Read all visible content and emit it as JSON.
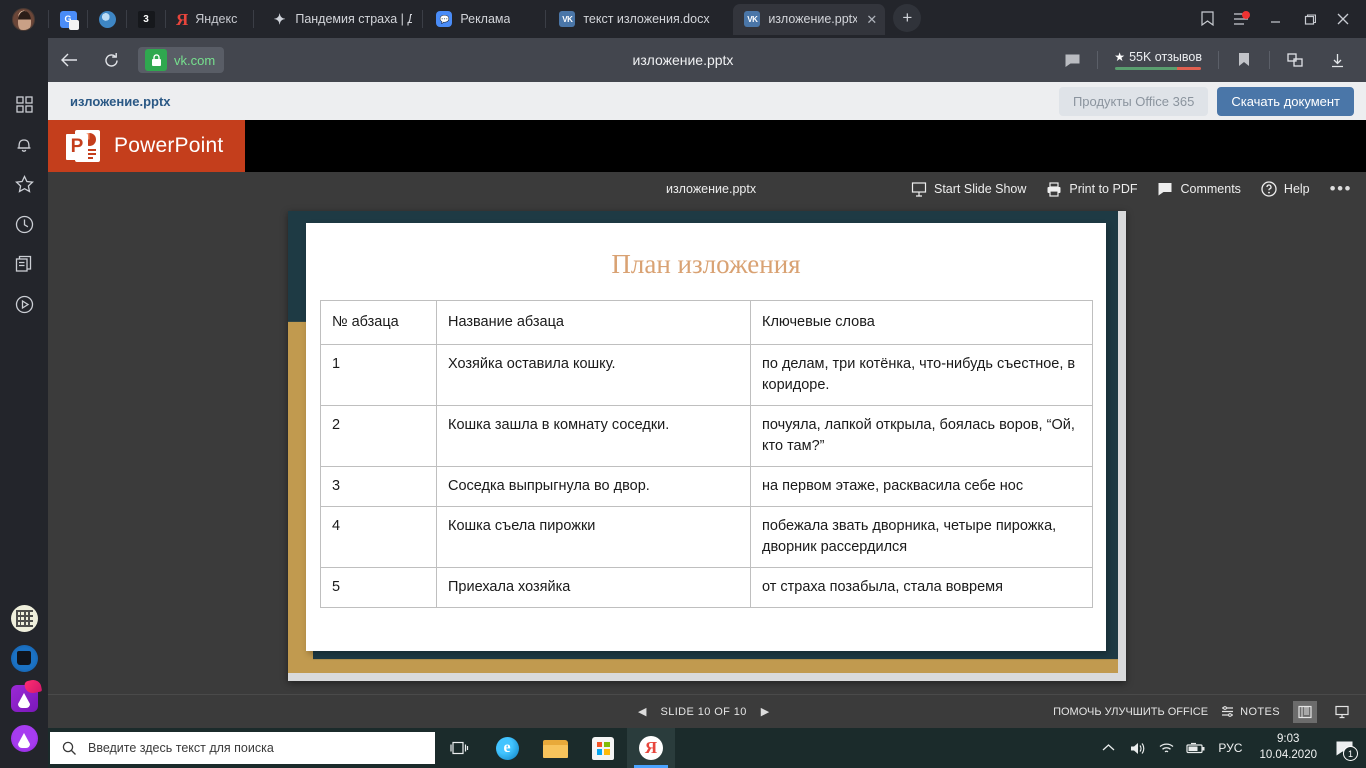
{
  "browser": {
    "pinned_tabs": [
      {
        "name": "avatar",
        "icon": "user-avatar-icon",
        "label": ""
      },
      {
        "name": "translate",
        "icon": "google-translate-icon",
        "label": "G"
      },
      {
        "name": "globe",
        "icon": "globe-icon",
        "label": ""
      },
      {
        "name": "counter",
        "icon": "badge-icon",
        "label": "3"
      },
      {
        "name": "yandex",
        "icon": "yandex-logo-icon",
        "label": "Я",
        "title": "Яндекс"
      }
    ],
    "yandex_label": "Яндекс",
    "tabs": [
      {
        "title": "Пандемия страха | Дне",
        "icon": "sparkle-icon",
        "active": false
      },
      {
        "title": "Реклама",
        "icon": "message-icon",
        "active": false
      },
      {
        "title": "текст изложения.docx",
        "icon": "vk-icon",
        "active": false
      },
      {
        "title": "изложение.pptx",
        "icon": "vk-icon",
        "active": true
      }
    ],
    "new_tab_label": "+",
    "close_tab_label": "✕",
    "window_controls": {
      "minimize": "—",
      "maximize": "▢",
      "close": "✕"
    },
    "address": {
      "url": "vk.com",
      "lock_icon": "lock-icon",
      "back_icon": "back-arrow-icon",
      "reload_icon": "reload-icon"
    },
    "page_title": "изложение.pptx",
    "rating": {
      "stars_label": "55K отзывов",
      "star_icon": "star-icon"
    },
    "toolbar_icons": [
      "comment-icon",
      "bookmark-icon",
      "extensions-icon",
      "download-icon"
    ]
  },
  "sidebar": {
    "items": [
      {
        "name": "apps-grid-icon"
      },
      {
        "name": "bell-icon"
      },
      {
        "name": "star-icon"
      },
      {
        "name": "history-clock-icon"
      },
      {
        "name": "documents-icon"
      },
      {
        "name": "play-circle-icon"
      }
    ],
    "apps": [
      {
        "name": "qr-code-app-icon"
      },
      {
        "name": "blue-app-icon"
      },
      {
        "name": "magenta-app-icon"
      },
      {
        "name": "purple-app-icon"
      }
    ]
  },
  "vk": {
    "filename": "изложение.pptx",
    "office_button": "Продукты Office 365",
    "download_button": "Скачать документ"
  },
  "powerpoint": {
    "brand": "PowerPoint",
    "file_label": "изложение.pptx",
    "toolbar": [
      {
        "label": "Start Slide Show",
        "icon": "slideshow-icon"
      },
      {
        "label": "Print to PDF",
        "icon": "printer-icon"
      },
      {
        "label": "Comments",
        "icon": "comment-icon"
      },
      {
        "label": "Help",
        "icon": "help-icon"
      }
    ],
    "more_label": "•••",
    "status": {
      "prev_icon": "prev-arrow-icon",
      "next_icon": "next-arrow-icon",
      "slide_counter": "SLIDE 10 OF 10",
      "improve_office": "ПОМОЧЬ УЛУЧШИТЬ OFFICE",
      "notes_label": "NOTES",
      "notes_icon": "notes-icon",
      "reading_view_icon": "reading-view-icon",
      "slideshow_view_icon": "slideshow-view-icon"
    }
  },
  "slide": {
    "title": "План изложения",
    "table": {
      "headers": [
        "№ абзаца",
        "Название абзаца",
        "Ключевые слова"
      ],
      "rows": [
        [
          "1",
          "Хозяйка оставила кошку.",
          "по делам, три котёнка, что-нибудь съестное, в коридоре."
        ],
        [
          "2",
          "Кошка зашла в комнату соседки.",
          "почуяла, лапкой открыла, боялась воров, “Ой, кто там?”"
        ],
        [
          "3",
          "Соседка выпрыгнула во двор.",
          "на первом этаже, расквасила себе нос"
        ],
        [
          "4",
          "Кошка съела пирожки",
          "побежала звать дворника, четыре пирожка, дворник рассердился"
        ],
        [
          "5",
          "Приехала хозяйка",
          "от страха позабыла, стала вовремя"
        ]
      ]
    },
    "colors": {
      "title": "#d9a273",
      "frame": "#1e3a44",
      "accent": "#c19a4f"
    }
  },
  "taskbar": {
    "start_icon": "windows-start-icon",
    "search_placeholder": "Введите здесь текст для поиска",
    "search_icon": "search-icon",
    "apps": [
      {
        "name": "task-view-icon"
      },
      {
        "name": "edge-icon"
      },
      {
        "name": "file-explorer-icon"
      },
      {
        "name": "microsoft-store-icon"
      },
      {
        "name": "yandex-browser-icon"
      }
    ],
    "tray": {
      "chevron_icon": "chevron-up-icon",
      "volume_icon": "volume-icon",
      "wifi_icon": "wifi-icon",
      "battery_icon": "battery-icon",
      "language": "РУС",
      "time": "9:03",
      "date": "10.04.2020",
      "notification_icon": "notification-icon",
      "notification_count": "1"
    }
  }
}
